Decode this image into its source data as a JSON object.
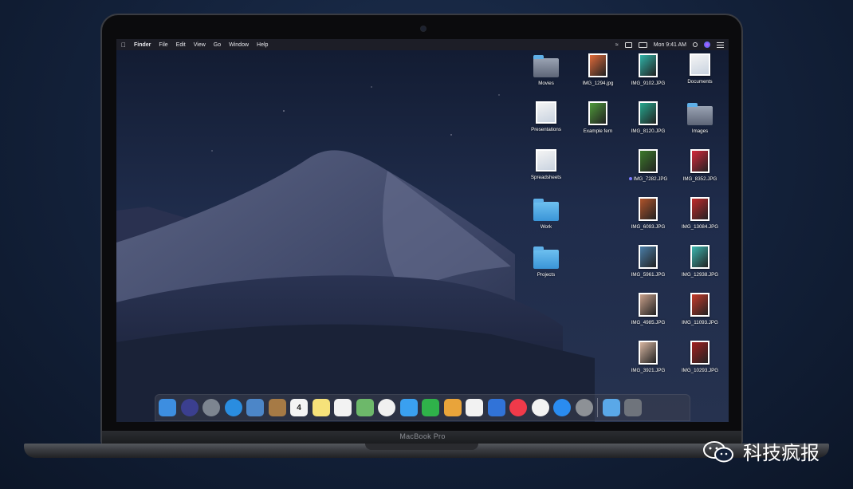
{
  "menubar": {
    "apple_icon": "apple-logo-icon",
    "items": [
      "Finder",
      "File",
      "Edit",
      "View",
      "Go",
      "Window",
      "Help"
    ],
    "clock": "Mon 9:41 AM"
  },
  "desktop_icons": [
    {
      "label": "Movies",
      "kind": "folder-dark"
    },
    {
      "label": "IMG_1294.jpg",
      "kind": "photo",
      "color": "#e06a3a"
    },
    {
      "label": "IMG_9102.JPG",
      "kind": "photo",
      "color": "#2fb3a8"
    },
    {
      "label": "Documents",
      "kind": "stack"
    },
    {
      "label": "Presentations",
      "kind": "stack"
    },
    {
      "label": "Example fern",
      "kind": "photo",
      "color": "#4f9a3a"
    },
    {
      "label": "IMG_8120.JPG",
      "kind": "photo",
      "color": "#25a88f"
    },
    {
      "label": "Images",
      "kind": "folder-dark"
    },
    {
      "label": "Spreadsheets",
      "kind": "stack"
    },
    {
      "label": "IMG_7282.JPG",
      "kind": "photo",
      "color": "#3c7a2a",
      "tagged": true
    },
    {
      "label": "IMG_8352.JPG",
      "kind": "photo",
      "color": "#d6283a"
    },
    {
      "label": "Work",
      "kind": "folder"
    },
    {
      "label": "IMG_6093.JPG",
      "kind": "photo",
      "color": "#b0532a"
    },
    {
      "label": "IMG_13084.JPG",
      "kind": "photo",
      "color": "#c22a2a"
    },
    {
      "label": "Projects",
      "kind": "folder"
    },
    {
      "label": "IMG_5961.JPG",
      "kind": "photo",
      "color": "#4a7ea8"
    },
    {
      "label": "IMG_12938.JPG",
      "kind": "photo",
      "color": "#3bb7b0"
    },
    {
      "label": "IMG_4985.JPG",
      "kind": "photo",
      "color": "#c9a08a"
    },
    {
      "label": "IMG_11093.JPG",
      "kind": "photo",
      "color": "#c73a2a"
    },
    {
      "label": "IMG_3921.JPG",
      "kind": "photo",
      "color": "#d7b5a0"
    },
    {
      "label": "IMG_10293.JPG",
      "kind": "photo",
      "color": "#a32020"
    }
  ],
  "dock": [
    {
      "name": "finder-icon",
      "color": "#3d8ee0",
      "glyph": ""
    },
    {
      "name": "siri-icon",
      "color": "#3b3f8f",
      "glyph": ""
    },
    {
      "name": "launchpad-icon",
      "color": "#7d8590",
      "glyph": ""
    },
    {
      "name": "safari-icon",
      "color": "#2a8de0",
      "glyph": ""
    },
    {
      "name": "mail-icon",
      "color": "#4c86c8",
      "glyph": ""
    },
    {
      "name": "contacts-icon",
      "color": "#a67a45",
      "glyph": ""
    },
    {
      "name": "calendar-icon",
      "color": "#f4f4f4",
      "glyph": "4"
    },
    {
      "name": "notes-icon",
      "color": "#f6e27a",
      "glyph": ""
    },
    {
      "name": "reminders-icon",
      "color": "#f2f2f2",
      "glyph": ""
    },
    {
      "name": "maps-icon",
      "color": "#6db86a",
      "glyph": ""
    },
    {
      "name": "photos-icon",
      "color": "#f0f0f0",
      "glyph": ""
    },
    {
      "name": "messages-icon",
      "color": "#3aa0f0",
      "glyph": ""
    },
    {
      "name": "facetime-icon",
      "color": "#2fb24a",
      "glyph": ""
    },
    {
      "name": "keynote-pages-icon",
      "color": "#e9a43a",
      "glyph": ""
    },
    {
      "name": "numbers-icon",
      "color": "#f2f2f2",
      "glyph": ""
    },
    {
      "name": "keynote-icon",
      "color": "#3173d8",
      "glyph": ""
    },
    {
      "name": "news-icon",
      "color": "#f03a4a",
      "glyph": ""
    },
    {
      "name": "music-icon",
      "color": "#f2f2f2",
      "glyph": ""
    },
    {
      "name": "app-store-icon",
      "color": "#2a8cf0",
      "glyph": ""
    },
    {
      "name": "system-preferences-icon",
      "color": "#8d9196",
      "glyph": ""
    },
    {
      "name": "downloads-folder-icon",
      "color": "#5aa8e8",
      "glyph": ""
    },
    {
      "name": "trash-icon",
      "color": "#6f747c",
      "glyph": ""
    }
  ],
  "laptop": {
    "model": "MacBook Pro"
  },
  "watermark": {
    "text": "科技疯报"
  }
}
